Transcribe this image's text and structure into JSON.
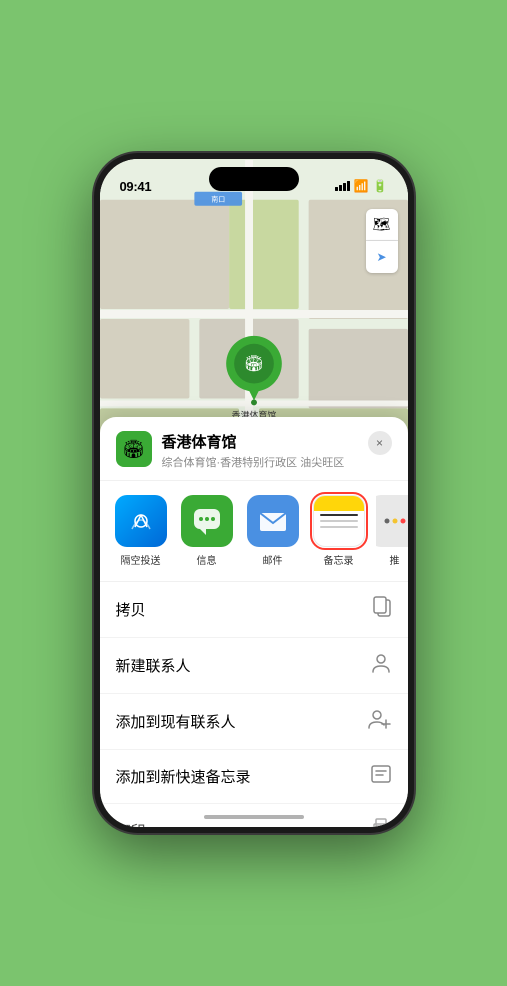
{
  "status": {
    "time": "09:41",
    "location_arrow": "▶"
  },
  "map": {
    "label_south_gate": "南口",
    "control_map": "🗺",
    "control_location": "➤"
  },
  "venue": {
    "name": "香港体育馆",
    "subtitle": "综合体育馆·香港特别行政区 油尖旺区",
    "icon": "🏟"
  },
  "share_apps": [
    {
      "id": "airdrop",
      "label": "隔空投送",
      "emoji": "📡"
    },
    {
      "id": "messages",
      "label": "信息",
      "emoji": "💬"
    },
    {
      "id": "mail",
      "label": "邮件",
      "emoji": "✉️"
    },
    {
      "id": "notes",
      "label": "备忘录",
      "selected": true
    },
    {
      "id": "more",
      "label": "推",
      "emoji": "···"
    }
  ],
  "actions": [
    {
      "id": "copy",
      "label": "拷贝",
      "icon": "copy"
    },
    {
      "id": "new-contact",
      "label": "新建联系人",
      "icon": "person"
    },
    {
      "id": "add-existing",
      "label": "添加到现有联系人",
      "icon": "person-add"
    },
    {
      "id": "add-notes",
      "label": "添加到新快速备忘录",
      "icon": "notes"
    },
    {
      "id": "print",
      "label": "打印",
      "icon": "print"
    }
  ],
  "close_label": "×"
}
